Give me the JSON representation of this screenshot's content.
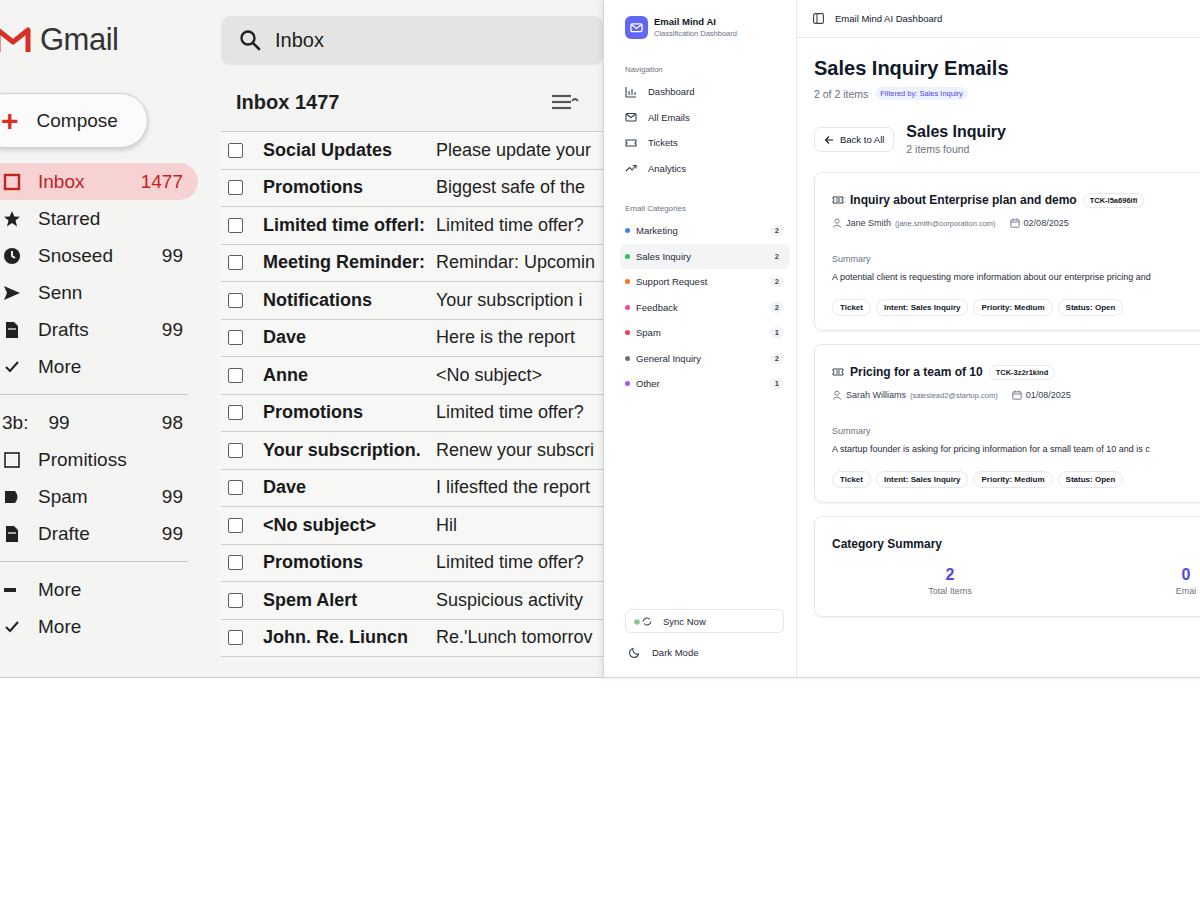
{
  "gmail": {
    "logo": "Gmail",
    "search": {
      "value": "Inbox"
    },
    "compose": {
      "icon": "+",
      "label": "Compose"
    },
    "sidebar": {
      "groups": [
        [
          {
            "kind": "nav",
            "label": "Inbox",
            "count": "1477",
            "selected": true
          },
          {
            "kind": "nav",
            "label": "Starred",
            "selected": false
          },
          {
            "kind": "nav",
            "label": "Snoseed",
            "count": "99",
            "selected": false
          },
          {
            "kind": "nav",
            "label": "Senn",
            "selected": false
          },
          {
            "kind": "nav",
            "label": "Drafts",
            "count": "99",
            "selected": false
          },
          {
            "kind": "nav",
            "label": "More",
            "selected": false
          }
        ],
        [
          {
            "kind": "plain",
            "label": "3b:",
            "extra": "99",
            "count": "98",
            "selected": false
          },
          {
            "kind": "nav",
            "label": "Promitioss",
            "selected": false
          },
          {
            "kind": "nav",
            "label": "Spam",
            "count": "99",
            "selected": false
          },
          {
            "kind": "nav",
            "label": "Drafte",
            "count": "99",
            "selected": false
          }
        ],
        [
          {
            "kind": "nav",
            "label": "More",
            "selected": false
          },
          {
            "kind": "nav",
            "label": "More",
            "selected": false
          }
        ]
      ]
    },
    "list": {
      "heading": "Inbox 1477",
      "rows": [
        {
          "sender": "Social Updates",
          "subject": "Please update your",
          "checked": false
        },
        {
          "sender": "Promotions",
          "subject": "Biggest safe of the",
          "checked": false
        },
        {
          "sender": "Limited time offerl:",
          "subject": "Limited time offer?",
          "checked": false
        },
        {
          "sender": "Meeting Reminder:",
          "subject": "Remindar: Upcomin",
          "checked": false
        },
        {
          "sender": "Notifications",
          "subject": "Your subscription i",
          "checked": false
        },
        {
          "sender": "Dave",
          "subject": "Here is the report",
          "checked": false
        },
        {
          "sender": "Anne",
          "subject": "<No subject>",
          "checked": false
        },
        {
          "sender": "Promotions",
          "subject": "Limited time offer?",
          "checked": false
        },
        {
          "sender": "Your subscription.",
          "subject": "Renew your subscri",
          "checked": false
        },
        {
          "sender": "Dave",
          "subject": "I lifesfted the report",
          "checked": false
        },
        {
          "sender": "<No subject>",
          "subject": "Hil",
          "checked": false
        },
        {
          "sender": "Promotions",
          "subject": "Limited time offer?",
          "checked": false
        },
        {
          "sender": "Spem Alert",
          "subject": "Suspicious activity",
          "checked": false
        },
        {
          "sender": "John. Re. Liuncn",
          "subject": "Re.'Lunch tomorrov",
          "checked": false
        }
      ]
    }
  },
  "dashboard": {
    "brand": {
      "name": "Email Mind AI",
      "subtitle": "Classification Dashboard"
    },
    "header_title": "Email Mind AI Dashboard",
    "navigation": {
      "label": "Navigation",
      "items": [
        {
          "label": "Dashboard",
          "selected": false
        },
        {
          "label": "All Emails",
          "selected": false
        },
        {
          "label": "Tickets",
          "selected": false
        },
        {
          "label": "Analytics",
          "selected": false
        }
      ]
    },
    "categories": {
      "label": "Email Categories",
      "items": [
        {
          "label": "Marketing",
          "count": "2",
          "color": "#3b82f6",
          "selected": false
        },
        {
          "label": "Sales Inquiry",
          "count": "2",
          "color": "#22c55e",
          "selected": true
        },
        {
          "label": "Support Request",
          "count": "2",
          "color": "#f97316",
          "selected": false
        },
        {
          "label": "Feedback",
          "count": "2",
          "color": "#ec4899",
          "selected": false
        },
        {
          "label": "Spam",
          "count": "1",
          "color": "#ef4444",
          "selected": false
        },
        {
          "label": "General Inquiry",
          "count": "2",
          "color": "#6b7280",
          "selected": false
        },
        {
          "label": "Other",
          "count": "1",
          "color": "#a855f7",
          "selected": false
        }
      ]
    },
    "sync_button": "Sync Now",
    "dark_mode": "Dark Mode",
    "page": {
      "title": "Sales Inquiry Emails",
      "count_text": "2 of 2 items",
      "filter_badge": "Filtered by: Sales Inquiry",
      "back_button": "Back to All",
      "section_title": "Sales Inquiry",
      "section_subtitle": "2 items found"
    },
    "emails": [
      {
        "subject": "Inquiry about Enterprise plan and demo",
        "ticket_id": "TCK-l5a696ifi",
        "sender": "Jane Smith",
        "sender_email": "(jane.smith@corporation.com)",
        "date": "02/08/2025",
        "summary_label": "Summary",
        "summary": "A potential client is requesting more information about our enterprise pricing and",
        "tags": [
          "Ticket",
          "Intent: Sales Inquiry",
          "Priority: Medium",
          "Status: Open"
        ]
      },
      {
        "subject": "Pricing for a team of 10",
        "ticket_id": "TCK-3z2r1kind",
        "sender": "Sarah Williams",
        "sender_email": "(saleslead2@startup.com)",
        "date": "01/08/2025",
        "summary_label": "Summary",
        "summary": "A startup founder is asking for pricing information for a small team of 10 and is c",
        "tags": [
          "Ticket",
          "Intent: Sales Inquiry",
          "Priority: Medium",
          "Status: Open"
        ]
      }
    ],
    "category_summary": {
      "title": "Category Summary",
      "stats": [
        {
          "value": "2",
          "label": "Total Items"
        },
        {
          "value": "0",
          "label": "Emai"
        }
      ]
    }
  }
}
